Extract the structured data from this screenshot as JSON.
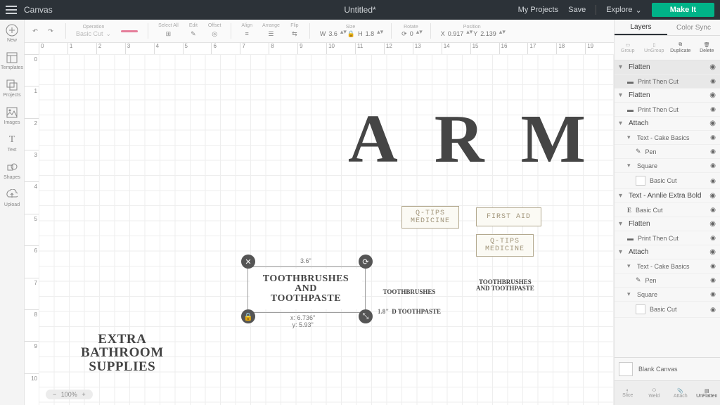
{
  "app": {
    "title": "Canvas",
    "doc_title": "Untitled*"
  },
  "header": {
    "my_projects": "My Projects",
    "save": "Save",
    "explore": "Explore",
    "makeit": "Make It"
  },
  "rail": {
    "new": "New",
    "templates": "Templates",
    "projects": "Projects",
    "images": "Images",
    "text": "Text",
    "shapes": "Shapes",
    "upload": "Upload"
  },
  "prop": {
    "operation": "Operation",
    "basic_cut": "Basic Cut",
    "select_all": "Select All",
    "edit": "Edit",
    "offset": "Offset",
    "align": "Align",
    "arrange": "Arrange",
    "flip": "Flip",
    "size": "Size",
    "w": "W",
    "w_val": "3.6",
    "h": "H",
    "h_val": "1.8",
    "rotate": "Rotate",
    "rot_val": "0",
    "position": "Position",
    "x": "X",
    "x_val": "0.917",
    "y": "Y",
    "y_val": "2.139"
  },
  "canvas": {
    "arm": "ARM",
    "qtips1": "Q-TIPS\nMEDICINE",
    "firstaid": "FIRST AID",
    "qtips2": "Q-TIPS\nMEDICINE",
    "tooth_main": "TOOTHBRUSHES\nAND\nTOOTHPASTE",
    "tooth_mid_top": "TOOTHBRUSHES",
    "tooth_mid_bot": "D TOOTHPASTE",
    "tooth_right": "TOOTHBRUSHES\nAND TOOTHPASTE",
    "extras": "EXTRA\nBATHROOM\nSUPPLIES",
    "sel_w": "3.6\"",
    "sel_h": "1.8\"",
    "sel_coord": "x: 6.736\"\ny: 5.93\"",
    "zoom": "100%"
  },
  "panel": {
    "tab_layers": "Layers",
    "tab_color": "Color Sync",
    "op_group": "Group",
    "op_ungroup": "UnGroup",
    "op_dup": "Duplicate",
    "op_del": "Delete",
    "flatten": "Flatten",
    "ptc": "Print Then Cut",
    "attach": "Attach",
    "text_cake": "Text - Cake Basics",
    "pen": "Pen",
    "square": "Square",
    "basic_cut": "Basic Cut",
    "text_annlie": "Text - Annlie Extra Bold",
    "blank_canvas": "Blank Canvas",
    "b_slice": "Slice",
    "b_weld": "Weld",
    "b_attach": "Attach",
    "b_unflatten": "UnFlatten"
  },
  "ruler_h": [
    "0",
    "1",
    "2",
    "3",
    "4",
    "5",
    "6",
    "7",
    "8",
    "9",
    "10",
    "11",
    "12",
    "13",
    "14",
    "15",
    "16",
    "17",
    "18",
    "19"
  ],
  "ruler_v": [
    "0",
    "1",
    "2",
    "3",
    "4",
    "5",
    "6",
    "7",
    "8",
    "9",
    "10"
  ]
}
